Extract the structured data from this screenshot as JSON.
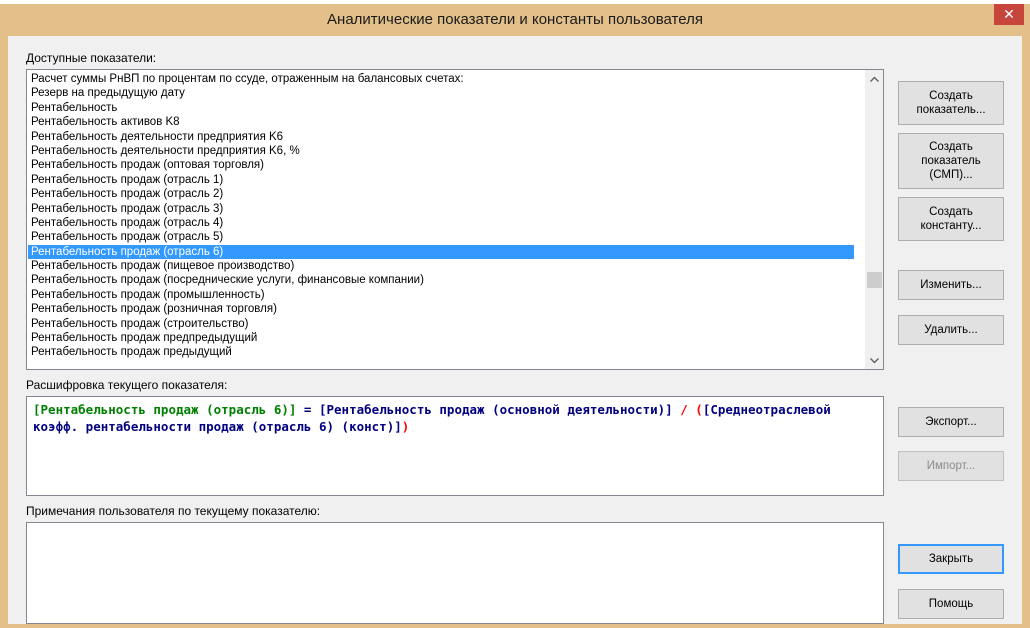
{
  "window": {
    "title": "Аналитические показатели и константы пользователя",
    "close_symbol": "✕"
  },
  "labels": {
    "available": "Доступные показатели:",
    "decoding": "Расшифровка текущего показателя:",
    "notes": "Примечания пользователя по текущему показателю:"
  },
  "list": {
    "items": [
      "Расчет суммы РнВП по процентам по ссуде, отраженным на балансовых счетах:",
      "Резерв на предыдущую дату",
      "Рентабельность",
      "Рентабельность активов K8",
      "Рентабельность деятельности предприятия K6",
      "Рентабельность деятельности предприятия K6, %",
      "Рентабельность продаж (оптовая торговля)",
      "Рентабельность продаж (отрасль 1)",
      "Рентабельность продаж (отрасль 2)",
      "Рентабельность продаж (отрасль 3)",
      "Рентабельность продаж (отрасль 4)",
      "Рентабельность продаж (отрасль 5)",
      "Рентабельность продаж (отрасль 6)",
      "Рентабельность продаж (пищевое производство)",
      "Рентабельность продаж (посреднические услуги, финансовые компании)",
      "Рентабельность продаж (промышленность)",
      "Рентабельность продаж (розничная торговля)",
      "Рентабельность продаж (строительство)",
      "Рентабельность продаж предпредыдущий",
      "Рентабельность продаж предыдущий"
    ],
    "selected_index": 12
  },
  "formula": {
    "part1": "[Рентабельность продаж (отрасль 6)]",
    "op_eq": " = ",
    "part2": "[Рентабельность продаж (основной деятельности)]",
    "op_div": " / ",
    "paren_open": "(",
    "part3": "[Среднеотраслевой коэфф. рентабельности продаж (отрасль 6) (конст)]",
    "paren_close": ")"
  },
  "notes": {
    "value": ""
  },
  "buttons": {
    "create_indicator": "Создать\nпоказатель...",
    "create_indicator_smp": "Создать\nпоказатель\n(СМП)...",
    "create_constant": "Создать\nконстанту...",
    "edit": "Изменить...",
    "delete": "Удалить...",
    "export": "Экспорт...",
    "import": "Импорт...",
    "close": "Закрыть",
    "help": "Помощь"
  },
  "icons": {
    "scroll_up": "chevron-up-icon",
    "scroll_down": "chevron-down-icon",
    "close": "close-icon"
  },
  "colors": {
    "titlebar": "#e3c08a",
    "selection": "#3399ff",
    "close_button": "#c7463c",
    "formula_green": "#008000",
    "formula_navy": "#000080",
    "formula_red": "#ff0000"
  }
}
